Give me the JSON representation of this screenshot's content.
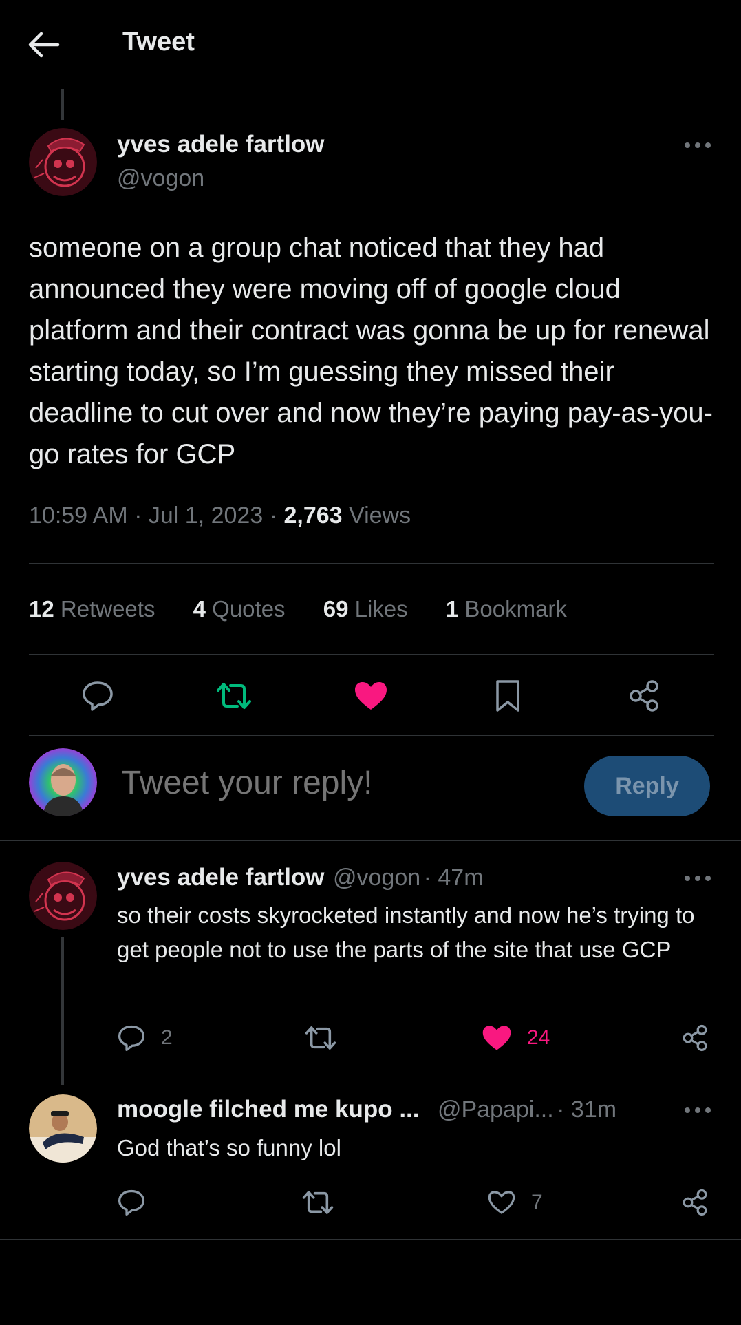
{
  "header": {
    "title": "Tweet"
  },
  "main_tweet": {
    "author_name": "yves adele fartlow",
    "author_handle": "@vogon",
    "text": "someone on a group chat noticed that they had announced they were moving off of google cloud platform and their contract was gonna be up for renewal starting today, so I’m guessing they missed their deadline to cut over and now they’re paying pay-as-you-go rates for GCP",
    "time": "10:59 AM",
    "date": "Jul 1, 2023",
    "views_count": "2,763",
    "views_label": "Views",
    "stats": [
      {
        "count": "12",
        "label": "Retweets"
      },
      {
        "count": "4",
        "label": "Quotes"
      },
      {
        "count": "69",
        "label": "Likes"
      },
      {
        "count": "1",
        "label": "Bookmark"
      }
    ]
  },
  "compose": {
    "placeholder": "Tweet your reply!",
    "button_label": "Reply"
  },
  "replies": [
    {
      "author_name": "yves adele fartlow",
      "author_handle": "@vogon",
      "age": "47m",
      "text": "so their costs skyrocketed instantly and now he’s trying to get people not to use the parts of the site that use GCP",
      "reply_count": "2",
      "retweet_count": "",
      "like_count": "24",
      "liked": true
    },
    {
      "author_name": "moogle filched me kupo ...",
      "author_handle": "@Papapi...",
      "age": "31m",
      "text": "God that’s so funny lol",
      "reply_count": "",
      "retweet_count": "",
      "like_count": "7",
      "liked": false
    }
  ],
  "colors": {
    "background": "#000000",
    "text_primary": "#e7e9ea",
    "text_secondary": "#71767b",
    "divider": "#2f3336",
    "like_pink": "#f91880",
    "retweet_green": "#00ba7c",
    "reply_button_bg": "#1d4c76"
  },
  "icons": {
    "back": "arrow-left-icon",
    "more": "more-horizontal-icon",
    "reply": "reply-bubble-icon",
    "retweet": "retweet-icon",
    "like": "heart-icon",
    "bookmark": "bookmark-icon",
    "share": "share-icon"
  }
}
